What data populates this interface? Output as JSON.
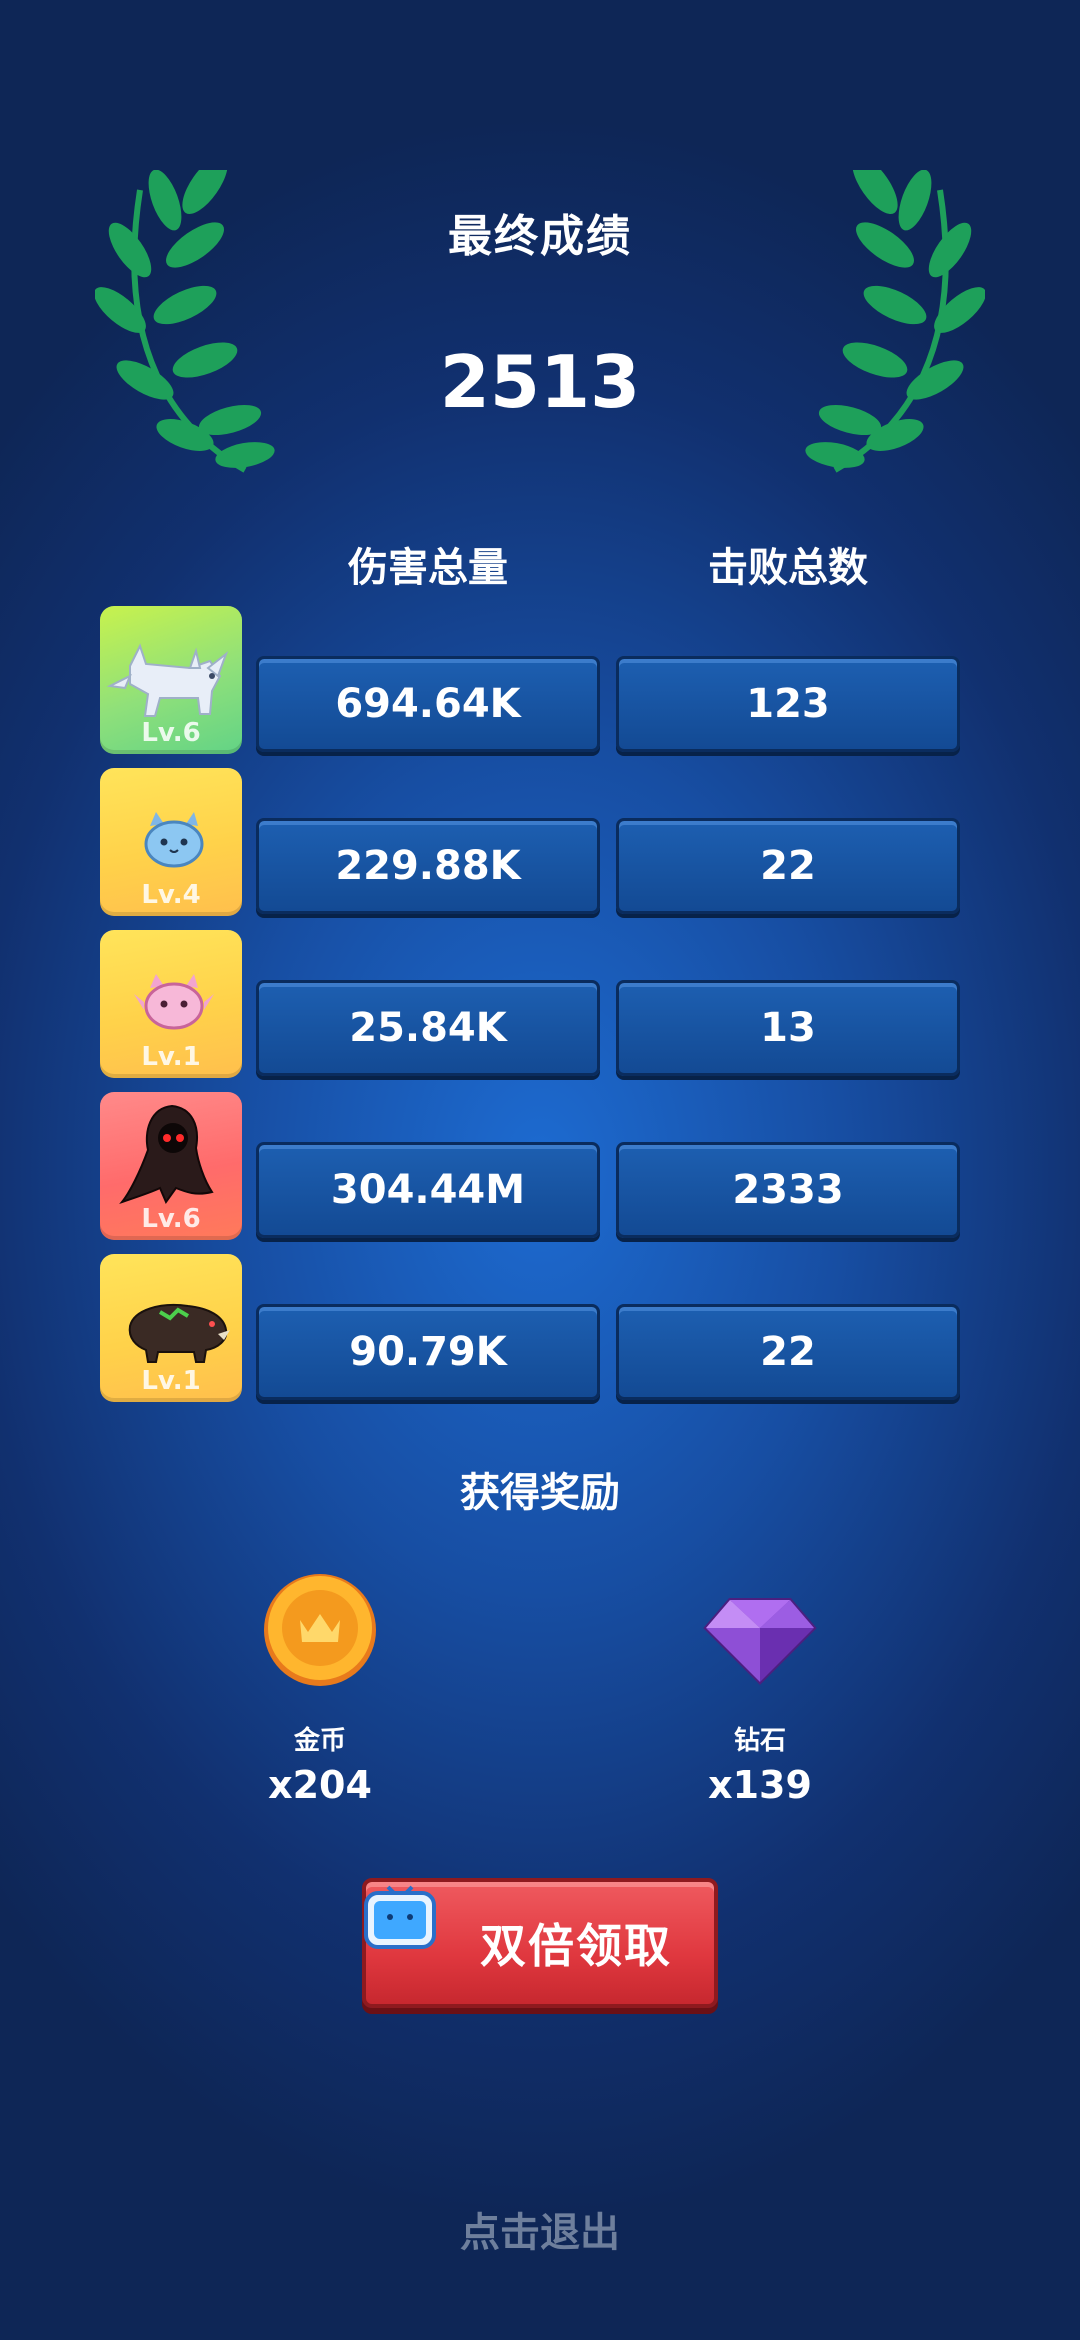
{
  "header": {
    "title": "最终成绩",
    "score": "2513"
  },
  "columns": {
    "damage": "伤害总量",
    "kills": "击败总数"
  },
  "rows": [
    {
      "level": "Lv.6",
      "damage": "694.64K",
      "kills": "123",
      "pet": "white-wolf-icon",
      "bg": "#8fe07a"
    },
    {
      "level": "Lv.4",
      "damage": "229.88K",
      "kills": "22",
      "pet": "blue-slime-icon",
      "bg": "#ffd24a"
    },
    {
      "level": "Lv.1",
      "damage": "25.84K",
      "kills": "13",
      "pet": "pink-slime-icon",
      "bg": "#ffd24a"
    },
    {
      "level": "Lv.6",
      "damage": "304.44M",
      "kills": "2333",
      "pet": "reaper-icon",
      "bg": "#ff6b6b"
    },
    {
      "level": "Lv.1",
      "damage": "90.79K",
      "kills": "22",
      "pet": "boar-icon",
      "bg": "#ffd24a"
    }
  ],
  "rewards": {
    "title": "获得奖励",
    "items": [
      {
        "name": "金币",
        "amount": "x204",
        "icon": "gold-coin-icon"
      },
      {
        "name": "钻石",
        "amount": "x139",
        "icon": "purple-gem-icon"
      }
    ]
  },
  "buttons": {
    "double_claim": "双倍领取",
    "exit": "点击退出"
  },
  "colors": {
    "background": "#174ea3",
    "cell": "#134a94",
    "button_red": "#e0383f",
    "laurel": "#1ea05a"
  }
}
